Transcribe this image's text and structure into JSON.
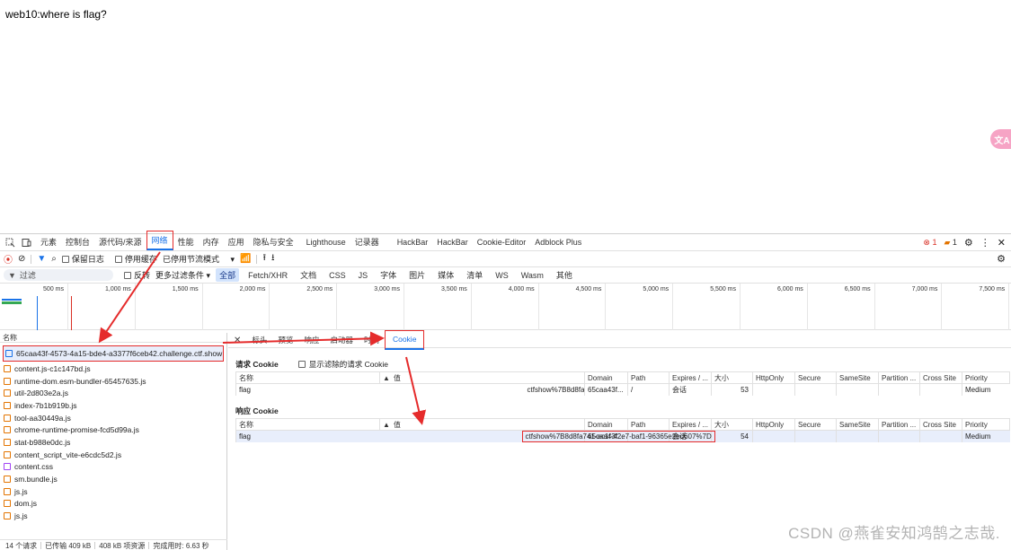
{
  "page": {
    "text": "web10:where is flag?",
    "translate_button": "文A"
  },
  "devtools": {
    "tabs": [
      "元素",
      "控制台",
      "源代码/来源",
      "网络",
      "性能",
      "内存",
      "应用",
      "隐私与安全",
      "Lighthouse",
      "记录器",
      "HackBar",
      "HackBar",
      "Cookie-Editor",
      "Adblock Plus"
    ],
    "active_tab": "网络",
    "error_count": "1",
    "warning_count": "1",
    "toolbar": {
      "preserve_log": "保留日志",
      "disable_cache": "停用缓存",
      "throttle": "已停用节流模式"
    },
    "filter": {
      "placeholder": "过滤",
      "invert": "反转",
      "more_filters": "更多过滤条件",
      "types": [
        "全部",
        "Fetch/XHR",
        "文档",
        "CSS",
        "JS",
        "字体",
        "图片",
        "媒体",
        "清单",
        "WS",
        "Wasm",
        "其他"
      ]
    },
    "timeline_labels": [
      "500 ms",
      "1,000 ms",
      "1,500 ms",
      "2,000 ms",
      "2,500 ms",
      "3,000 ms",
      "3,500 ms",
      "4,000 ms",
      "4,500 ms",
      "5,000 ms",
      "5,500 ms",
      "6,000 ms",
      "6,500 ms",
      "7,000 ms",
      "7,500 ms"
    ],
    "request_list": {
      "header": "名称",
      "rows": [
        {
          "name": "65caa43f-4573-4a15-bde4-a3377f6ceb42.challenge.ctf.show",
          "type": "doc"
        },
        {
          "name": "content.js-c1c147bd.js",
          "type": "js"
        },
        {
          "name": "runtime-dom.esm-bundler-65457635.js",
          "type": "js"
        },
        {
          "name": "util-2d803e2a.js",
          "type": "js"
        },
        {
          "name": "index-7b1b919b.js",
          "type": "js"
        },
        {
          "name": "tool-aa30449a.js",
          "type": "js"
        },
        {
          "name": "chrome-runtime-promise-fcd5d99a.js",
          "type": "js"
        },
        {
          "name": "stat-b988e0dc.js",
          "type": "js"
        },
        {
          "name": "content_script_vite-e6cdc5d2.js",
          "type": "js"
        },
        {
          "name": "content.css",
          "type": "css"
        },
        {
          "name": "sm.bundle.js",
          "type": "js"
        },
        {
          "name": "js.js",
          "type": "js"
        },
        {
          "name": "dom.js",
          "type": "js"
        },
        {
          "name": "js.js",
          "type": "js"
        }
      ]
    },
    "status": {
      "requests": "14 个请求",
      "transferred": "已传输 409 kB",
      "resources": "408 kB 项资源",
      "finish": "完成用时: 6.63 秒"
    },
    "detail_tabs": [
      "标头",
      "预览",
      "响应",
      "启动器",
      "时间",
      "Cookie"
    ],
    "active_detail_tab": "Cookie",
    "request_cookies": {
      "title": "请求 Cookie",
      "show_filtered": "显示滤除的请求 Cookie",
      "columns": [
        "名称",
        "值",
        "Domain",
        "Path",
        "Expires / ...",
        "大小",
        "HttpOnly",
        "Secure",
        "SameSite",
        "Partition ...",
        "Cross Site",
        "Priority"
      ],
      "rows": [
        {
          "name": "flag",
          "value": "ctfshow%7B8d8fa741-ac1f-42e7-baf1-96365e2bd607%7D",
          "domain": "65caa43f...",
          "path": "/",
          "expires": "会话",
          "size": "53",
          "httponly": "",
          "secure": "",
          "samesite": "",
          "partition": "",
          "crosssite": "",
          "priority": "Medium"
        }
      ]
    },
    "response_cookies": {
      "title": "响应 Cookie",
      "columns": [
        "名称",
        "值",
        "Domain",
        "Path",
        "Expires / ...",
        "大小",
        "HttpOnly",
        "Secure",
        "SameSite",
        "Partition ...",
        "Cross Site",
        "Priority"
      ],
      "rows": [
        {
          "name": "flag",
          "value": "ctfshow%7B8d8fa741-ac1f-42e7-baf1-96365e2bd607%7D",
          "domain": "65caa43f...",
          "path": "",
          "expires": "会话",
          "size": "54",
          "httponly": "",
          "secure": "",
          "samesite": "",
          "partition": "",
          "crosssite": "",
          "priority": "Medium"
        }
      ]
    }
  },
  "watermark": "CSDN @燕雀安知鸿鹄之志哉.",
  "colors": {
    "accent": "#1a73e8",
    "annotation": "#e52b2b",
    "selected_row": "#e8eefb"
  }
}
